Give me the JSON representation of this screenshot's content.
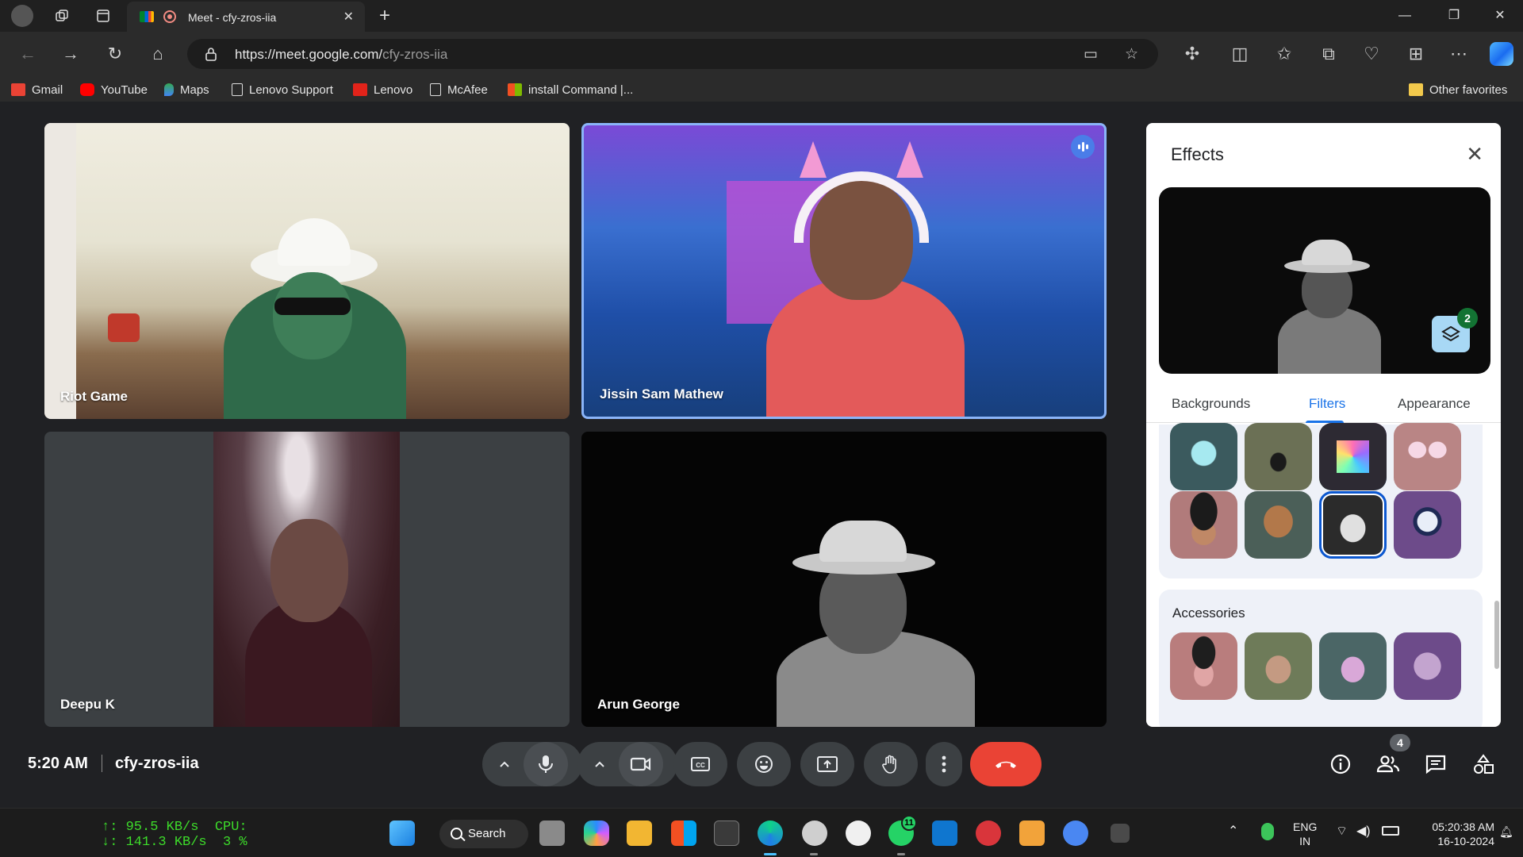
{
  "browser": {
    "tab_title": "Meet - cfy-zros-iia",
    "new_tab": "+",
    "url_host": "https://meet.google.com/",
    "url_path": "cfy-zros-iia",
    "bookmarks": [
      {
        "label": "Gmail"
      },
      {
        "label": "YouTube"
      },
      {
        "label": "Maps"
      },
      {
        "label": "Lenovo Support"
      },
      {
        "label": "Lenovo"
      },
      {
        "label": "McAfee"
      },
      {
        "label": "install Command |..."
      }
    ],
    "other_favorites": "Other favorites"
  },
  "meet": {
    "participants": [
      {
        "name": "Riot Game"
      },
      {
        "name": "Jissin Sam Mathew"
      },
      {
        "name": "Deepu K"
      },
      {
        "name": "Arun George"
      }
    ],
    "time": "5:20 AM",
    "meeting_code": "cfy-zros-iia",
    "people_count": "4"
  },
  "effects": {
    "title": "Effects",
    "layer_count": "2",
    "tabs": [
      "Backgrounds",
      "Filters",
      "Appearance"
    ],
    "active_tab": "Filters",
    "accessories_title": "Accessories"
  },
  "taskbar": {
    "net_up": "↑: 95.5 KB/s",
    "net_down": "↓: 141.3 KB/s",
    "cpu_label": "CPU:",
    "cpu_value": "3 %",
    "search_label": "Search",
    "lang_1": "ENG",
    "lang_2": "IN",
    "clock_time": "05:20:38 AM",
    "clock_date": "16-10-2024",
    "whatsapp_badge": "11"
  }
}
